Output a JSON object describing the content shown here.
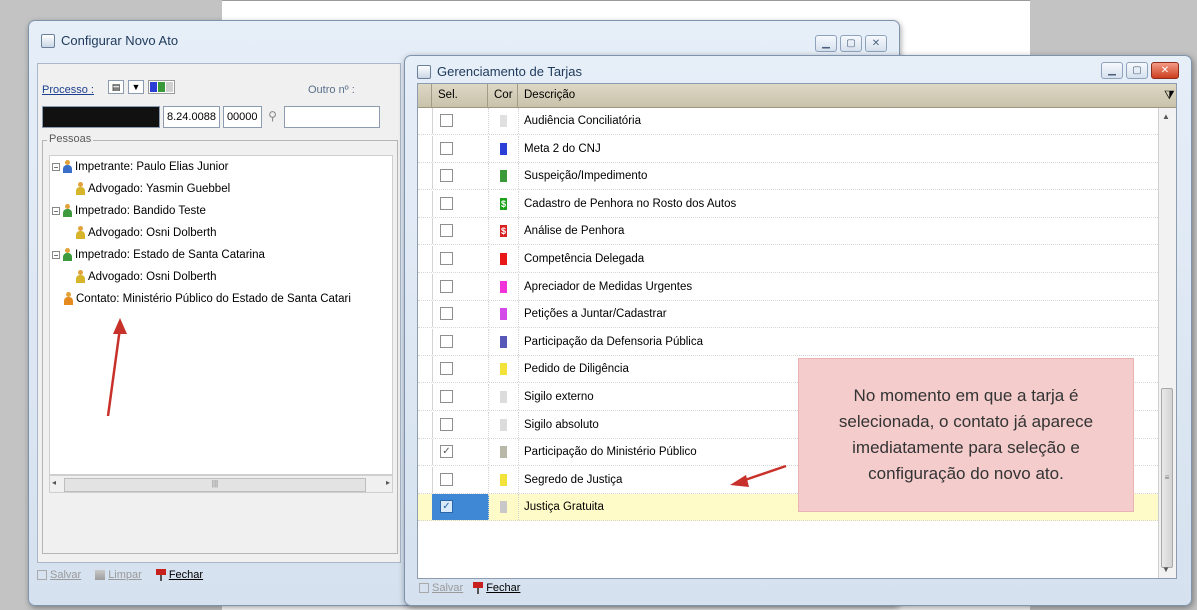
{
  "window_main": {
    "title": "Configurar Novo Ato",
    "processo_label": "Processo :",
    "outro_label": "Outro nº :",
    "process_number_part": "8.24.0088",
    "process_number_part2": "00000",
    "pessoas_label": "Pessoas",
    "tree": [
      {
        "label": "Impetrante: Paulo Elias Junior",
        "level": 0,
        "expander": "−",
        "icon_color": "blue"
      },
      {
        "label": "Advogado: Yasmin Guebbel",
        "level": 1,
        "icon_color": "yellow"
      },
      {
        "label": "Impetrado: Bandido Teste",
        "level": 0,
        "expander": "−",
        "icon_color": "green"
      },
      {
        "label": "Advogado: Osni Dolberth",
        "level": 1,
        "icon_color": "yellow"
      },
      {
        "label": "Impetrado: Estado de Santa Catarina",
        "level": 0,
        "expander": "−",
        "icon_color": "green"
      },
      {
        "label": "Advogado: Osni Dolberth",
        "level": 1,
        "icon_color": "yellow"
      },
      {
        "label": "Contato: Ministério Público do Estado de Santa Catari",
        "level": 0,
        "icon_color": "orange"
      }
    ],
    "footer": {
      "save": "Salvar",
      "clear": "Limpar",
      "close": "Fechar"
    }
  },
  "window_tarjas": {
    "title": "Gerenciamento de Tarjas",
    "columns": {
      "sel": "Sel.",
      "cor": "Cor",
      "desc": "Descrição"
    },
    "rows": [
      {
        "desc": "Audiência Conciliatória",
        "checked": false,
        "color": "#e0e0e0"
      },
      {
        "desc": "Meta 2 do CNJ",
        "checked": false,
        "color": "#2b3fd6"
      },
      {
        "desc": "Suspeição/Impedimento",
        "checked": false,
        "color": "#3a9a3a"
      },
      {
        "desc": "Cadastro de Penhora no Rosto dos Autos",
        "checked": false,
        "color": "#1aa31a",
        "glyph": "$"
      },
      {
        "desc": "Análise de Penhora",
        "checked": false,
        "color": "#d92020",
        "glyph": "$"
      },
      {
        "desc": "Competência Delegada",
        "checked": false,
        "color": "#e81818"
      },
      {
        "desc": "Apreciador de Medidas Urgentes",
        "checked": false,
        "color": "#f032d8"
      },
      {
        "desc": "Petições a Juntar/Cadastrar",
        "checked": false,
        "color": "#d44ae8"
      },
      {
        "desc": "Participação da Defensoria Pública",
        "checked": false,
        "color": "#5858b8"
      },
      {
        "desc": "Pedido de Diligência",
        "checked": false,
        "color": "#f3e23a"
      },
      {
        "desc": "Sigilo externo",
        "checked": false,
        "color": "#dcdcdc"
      },
      {
        "desc": "Sigilo absoluto",
        "checked": false,
        "color": "#dcdcdc"
      },
      {
        "desc": "Participação do Ministério Público",
        "checked": true,
        "color": "#b8b8a8"
      },
      {
        "desc": "Segredo de Justiça",
        "checked": false,
        "color": "#f3e23a"
      },
      {
        "desc": "Justiça Gratuita",
        "checked": true,
        "color": "#c8c8c8",
        "selected": true
      }
    ],
    "footer": {
      "save": "Salvar",
      "close": "Fechar"
    }
  },
  "callout": "No momento em que a tarja é selecionada, o contato já aparece imediatamente para seleção e configuração do novo ato."
}
